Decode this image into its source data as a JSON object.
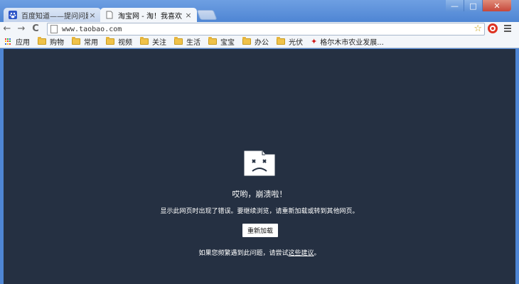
{
  "tabs": [
    {
      "title": "百度知道——提问问题",
      "close": "×",
      "icon": "baidu-paw-icon",
      "active": false
    },
    {
      "title": "淘宝网 - 淘！我喜欢",
      "close": "×",
      "icon": "page-icon",
      "active": true
    }
  ],
  "window_controls": {
    "minimize": "—",
    "maximize": "□",
    "close": "✕"
  },
  "toolbar": {
    "back": "←",
    "forward": "→",
    "reload": "C",
    "url": "www.taobao.com",
    "star": "☆"
  },
  "bookmarks": [
    {
      "label": "应用",
      "type": "apps"
    },
    {
      "label": "购物",
      "type": "folder"
    },
    {
      "label": "常用",
      "type": "folder"
    },
    {
      "label": "视频",
      "type": "folder"
    },
    {
      "label": "关注",
      "type": "folder"
    },
    {
      "label": "生活",
      "type": "folder"
    },
    {
      "label": "宝宝",
      "type": "folder"
    },
    {
      "label": "办公",
      "type": "folder"
    },
    {
      "label": "光伏",
      "type": "folder"
    },
    {
      "label": "格尔木市农业发展...",
      "type": "pin"
    }
  ],
  "crash": {
    "title": "哎哟，崩溃啦！",
    "message": "显示此网页时出现了错误。要继续浏览，请重新加载或转到其他网页。",
    "reload_label": "重新加载",
    "help_prefix": "如果您频繁遇到此问题，请尝试",
    "help_link": "这些建议",
    "help_suffix": "。"
  },
  "colors": {
    "content_bg": "#253042",
    "frame": "#4f86d4"
  }
}
